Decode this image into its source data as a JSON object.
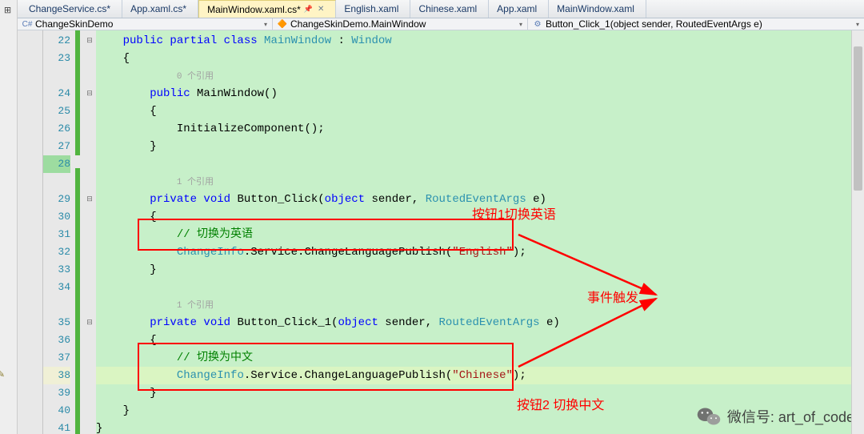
{
  "tabs": [
    {
      "label": "ChangeService.cs*"
    },
    {
      "label": "App.xaml.cs*"
    },
    {
      "label": "MainWindow.xaml.cs*",
      "active": true
    },
    {
      "label": "English.xaml"
    },
    {
      "label": "Chinese.xaml"
    },
    {
      "label": "App.xaml"
    },
    {
      "label": "MainWindow.xaml"
    }
  ],
  "crumbs": {
    "namespace": "ChangeSkinDemo",
    "class": "ChangeSkinDemo.MainWindow",
    "member": "Button_Click_1(object sender, RoutedEventArgs e)"
  },
  "line_start": 22,
  "refs": {
    "zero": "0 个引用",
    "one": "1 个引用"
  },
  "code": {
    "l22": {
      "pre": "    ",
      "kw": "public partial class ",
      "type": "MainWindow",
      "mid": " : ",
      "base": "Window"
    },
    "l23": "    {",
    "l24": {
      "pre": "        ",
      "kw": "public ",
      "name": "MainWindow",
      "post": "()"
    },
    "l25": "        {",
    "l26": "            InitializeComponent();",
    "l27": "        }",
    "l29": {
      "pre": "        ",
      "kw": "private void ",
      "name": "Button_Click",
      "mid": "(",
      "kw2": "object",
      "mid2": " sender, ",
      "type": "RoutedEventArgs",
      "post": " e)"
    },
    "l30": "        {",
    "l31": {
      "pre": "            ",
      "cmt": "// 切换为英语"
    },
    "l32": {
      "pre": "            ",
      "type": "ChangeInfo",
      "mid": ".Service.ChangeLanguagePublish(",
      "str": "\"English\"",
      "post": ");"
    },
    "l33": "        }",
    "l35": {
      "pre": "        ",
      "kw": "private void ",
      "name": "Button_Click_1",
      "mid": "(",
      "kw2": "object",
      "mid2": " sender, ",
      "type": "RoutedEventArgs",
      "post": " e)"
    },
    "l36": "        {",
    "l37": {
      "pre": "            ",
      "cmt": "// 切换为中文"
    },
    "l38": {
      "pre": "            ",
      "type": "ChangeInfo",
      "mid": ".Service.ChangeLanguagePublish(",
      "str": "\"Chinese\"",
      "post": ");"
    },
    "l39": "        }",
    "l40": "    }",
    "l41": "}"
  },
  "annotations": {
    "btn1": "按钮1切换英语",
    "event": "事件触发",
    "btn2": "按钮2 切换中文"
  },
  "watermark": {
    "label": "微信号: art_of_code"
  }
}
